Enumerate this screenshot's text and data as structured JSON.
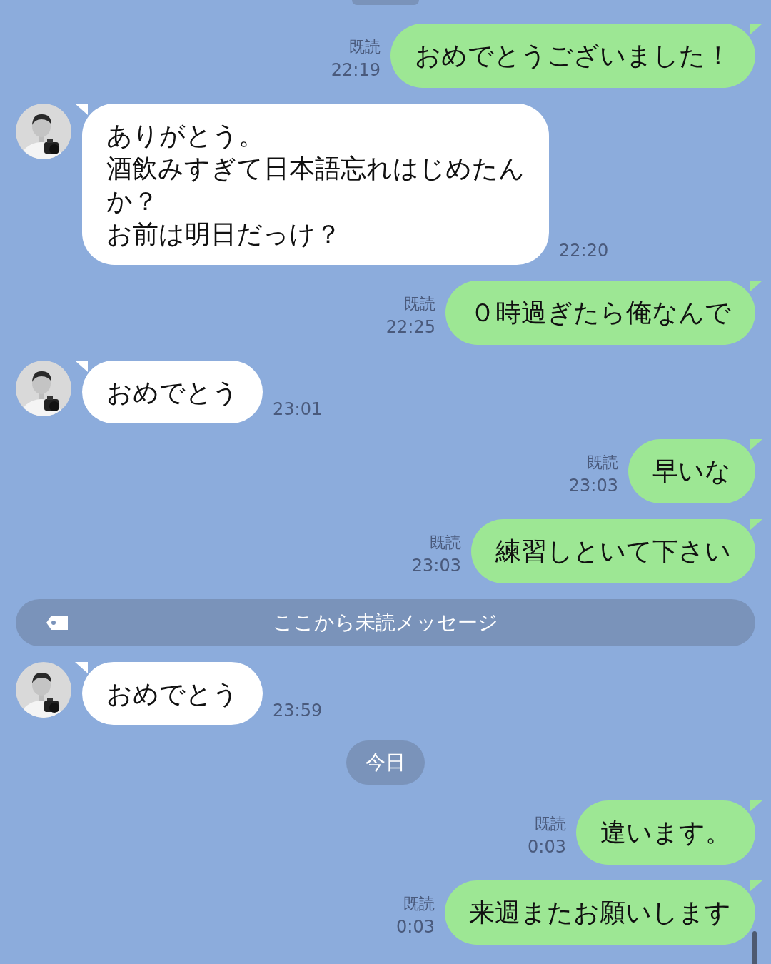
{
  "messages": [
    {
      "kind": "sent",
      "read_label": "既読",
      "time": "22:19",
      "lines": [
        "おめでとうございました！"
      ]
    },
    {
      "kind": "received",
      "time": "22:20",
      "lines": [
        "ありがとう。",
        "酒飲みすぎて日本語忘れはじめたん",
        "か？",
        "お前は明日だっけ？"
      ]
    },
    {
      "kind": "sent",
      "read_label": "既読",
      "time": "22:25",
      "lines": [
        "０時過ぎたら俺なんで"
      ]
    },
    {
      "kind": "received",
      "time": "23:01",
      "lines": [
        "おめでとう"
      ]
    },
    {
      "kind": "sent",
      "read_label": "既読",
      "time": "23:03",
      "lines": [
        "早いな"
      ]
    },
    {
      "kind": "sent",
      "read_label": "既読",
      "time": "23:03",
      "lines": [
        "練習しといて下さい"
      ]
    },
    {
      "kind": "unread_divider",
      "text": "ここから未読メッセージ"
    },
    {
      "kind": "received",
      "time": "23:59",
      "lines": [
        "おめでとう"
      ]
    },
    {
      "kind": "date",
      "text": "今日"
    },
    {
      "kind": "sent",
      "read_label": "既読",
      "time": "0:03",
      "lines": [
        "違います。"
      ]
    },
    {
      "kind": "sent",
      "read_label": "既読",
      "time": "0:03",
      "lines": [
        "来週またお願いします"
      ]
    }
  ]
}
